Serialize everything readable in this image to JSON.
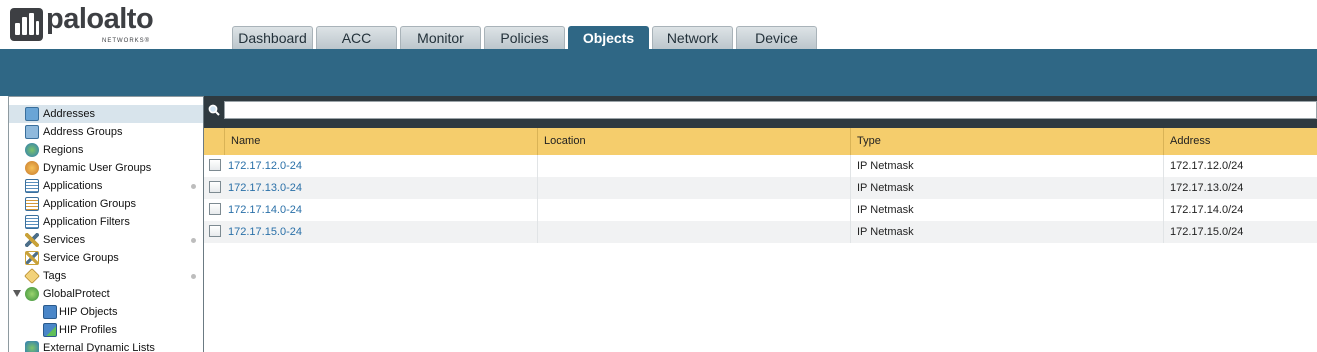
{
  "brand": {
    "name": "paloalto",
    "sub": "NETWORKS®"
  },
  "tabs": [
    {
      "label": "Dashboard",
      "active": false
    },
    {
      "label": "ACC",
      "active": false
    },
    {
      "label": "Monitor",
      "active": false
    },
    {
      "label": "Policies",
      "active": false
    },
    {
      "label": "Objects",
      "active": true
    },
    {
      "label": "Network",
      "active": false
    },
    {
      "label": "Device",
      "active": false
    }
  ],
  "sidebar": {
    "items": [
      {
        "label": "Addresses",
        "icon": "addresses-icon",
        "selected": true,
        "dot": false
      },
      {
        "label": "Address Groups",
        "icon": "address-groups-icon",
        "selected": false,
        "dot": false
      },
      {
        "label": "Regions",
        "icon": "globe-icon",
        "selected": false,
        "dot": false
      },
      {
        "label": "Dynamic User Groups",
        "icon": "users-icon",
        "selected": false,
        "dot": false
      },
      {
        "label": "Applications",
        "icon": "applications-icon",
        "selected": false,
        "dot": true
      },
      {
        "label": "Application Groups",
        "icon": "application-groups-icon",
        "selected": false,
        "dot": false
      },
      {
        "label": "Application Filters",
        "icon": "application-filters-icon",
        "selected": false,
        "dot": false
      },
      {
        "label": "Services",
        "icon": "services-icon",
        "selected": false,
        "dot": true
      },
      {
        "label": "Service Groups",
        "icon": "service-groups-icon",
        "selected": false,
        "dot": false
      },
      {
        "label": "Tags",
        "icon": "tag-icon",
        "selected": false,
        "dot": true
      },
      {
        "label": "GlobalProtect",
        "icon": "globalprotect-icon",
        "selected": false,
        "dot": false
      },
      {
        "label": "HIP Objects",
        "icon": "hip-objects-icon",
        "selected": false,
        "dot": false
      },
      {
        "label": "HIP Profiles",
        "icon": "hip-profiles-icon",
        "selected": false,
        "dot": false
      },
      {
        "label": "External Dynamic Lists",
        "icon": "external-lists-icon",
        "selected": false,
        "dot": false
      }
    ]
  },
  "search": {
    "placeholder": "",
    "value": ""
  },
  "table": {
    "columns": [
      "Name",
      "Location",
      "Type",
      "Address"
    ],
    "rows": [
      {
        "name": "172.17.12.0-24",
        "location": "",
        "type": "IP Netmask",
        "address": "172.17.12.0/24"
      },
      {
        "name": "172.17.13.0-24",
        "location": "",
        "type": "IP Netmask",
        "address": "172.17.13.0/24"
      },
      {
        "name": "172.17.14.0-24",
        "location": "",
        "type": "IP Netmask",
        "address": "172.17.14.0/24"
      },
      {
        "name": "172.17.15.0-24",
        "location": "",
        "type": "IP Netmask",
        "address": "172.17.15.0/24"
      }
    ]
  },
  "colors": {
    "accent": "#2f6785",
    "header_row": "#f5cd6c",
    "link": "#2a70a8"
  }
}
